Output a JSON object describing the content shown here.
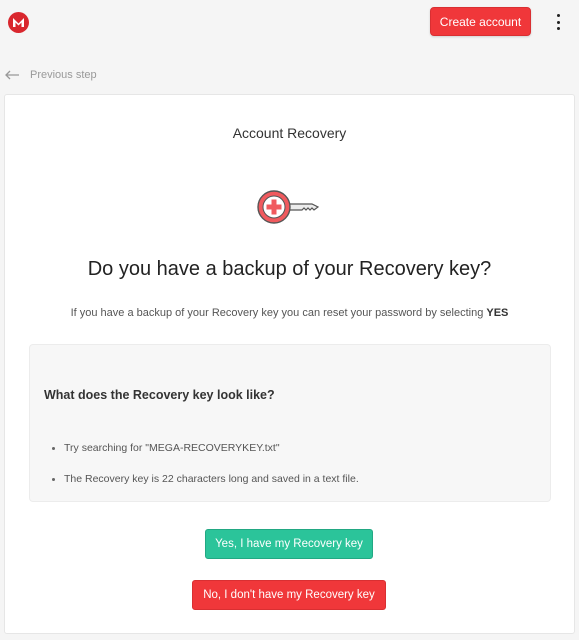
{
  "header": {
    "logo_icon": "mega-logo-icon",
    "create_account_label": "Create account",
    "menu_icon": "more-vertical-icon",
    "accent": "#f0373a"
  },
  "nav": {
    "back_icon": "arrow-left-icon",
    "previous_step_label": "Previous step"
  },
  "recovery": {
    "title": "Account Recovery",
    "key_icon": "recovery-key-icon",
    "question": "Do you have a backup of your Recovery key?",
    "description_text": "If you have a backup of your Recovery key you can reset your password by selecting",
    "description_emphasis": "YES",
    "info": {
      "title": "What does the Recovery key look like?",
      "items": [
        "Try searching for \"MEGA-RECOVERYKEY.txt\"",
        "The Recovery key is 22 characters long and saved in a text file."
      ]
    },
    "yes_button_label": "Yes, I have my Recovery key",
    "no_button_label": "No, I don't have my Recovery key",
    "yes_color": "#2bc49a",
    "no_color": "#f0373a"
  }
}
